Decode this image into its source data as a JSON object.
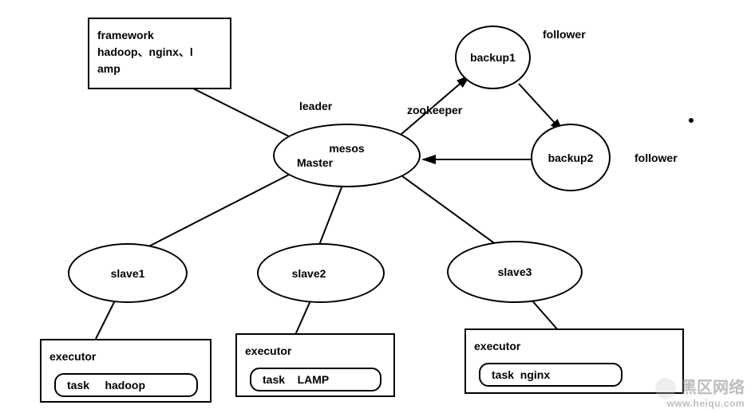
{
  "framework_box": {
    "line1": "framework",
    "line2": "hadoop、nginx、l",
    "line3": "amp"
  },
  "labels": {
    "leader": "leader",
    "zookeeper": "zookeeper",
    "follower1": "follower",
    "follower2": "follower"
  },
  "master": {
    "line1": "mesos",
    "line2": "Master"
  },
  "backups": {
    "b1": "backup1",
    "b2": "backup2"
  },
  "slaves": {
    "s1": "slave1",
    "s2": "slave2",
    "s3": "slave3"
  },
  "executors": {
    "e1": {
      "title": "executor",
      "task": "task     hadoop"
    },
    "e2": {
      "title": "executor",
      "task": "task    LAMP"
    },
    "e3": {
      "title": "executor",
      "task": "task  nginx"
    }
  },
  "watermark": {
    "text": "黑区网络",
    "sub": "www.heiqu.com"
  },
  "chart_data": {
    "type": "diagram",
    "title": "Mesos cluster architecture with ZooKeeper leader election",
    "nodes": [
      {
        "id": "framework",
        "shape": "rect",
        "label": "framework hadoop、nginx、lamp"
      },
      {
        "id": "master",
        "shape": "ellipse",
        "label": "mesos Master",
        "role": "leader"
      },
      {
        "id": "backup1",
        "shape": "circle",
        "label": "backup1",
        "role": "follower"
      },
      {
        "id": "backup2",
        "shape": "circle",
        "label": "backup2",
        "role": "follower"
      },
      {
        "id": "slave1",
        "shape": "ellipse",
        "label": "slave1"
      },
      {
        "id": "slave2",
        "shape": "ellipse",
        "label": "slave2"
      },
      {
        "id": "slave3",
        "shape": "ellipse",
        "label": "slave3"
      },
      {
        "id": "executor1",
        "shape": "rect",
        "label": "executor",
        "task": "task hadoop"
      },
      {
        "id": "executor2",
        "shape": "rect",
        "label": "executor",
        "task": "task LAMP"
      },
      {
        "id": "executor3",
        "shape": "rect",
        "label": "executor",
        "task": "task nginx"
      }
    ],
    "edges": [
      {
        "from": "framework",
        "to": "master"
      },
      {
        "from": "master",
        "to": "backup1",
        "directed": true,
        "label": "zookeeper"
      },
      {
        "from": "backup1",
        "to": "backup2",
        "directed": true
      },
      {
        "from": "backup2",
        "to": "master",
        "directed": true
      },
      {
        "from": "master",
        "to": "slave1"
      },
      {
        "from": "master",
        "to": "slave2"
      },
      {
        "from": "master",
        "to": "slave3"
      },
      {
        "from": "slave1",
        "to": "executor1"
      },
      {
        "from": "slave2",
        "to": "executor2"
      },
      {
        "from": "slave3",
        "to": "executor3"
      }
    ]
  }
}
